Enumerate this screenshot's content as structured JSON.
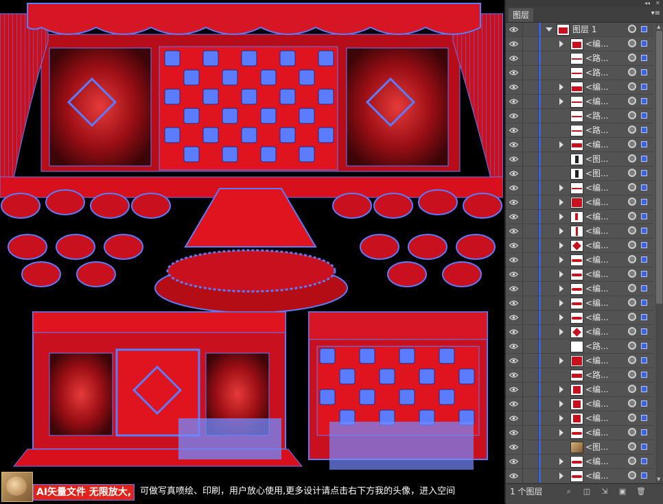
{
  "canvas": {
    "footer_highlight": "AI矢量文件 无限放大,",
    "footer_text": "可做写真喷绘、印刷，用户放心使用,更多设计请点击右下方我的头像，进入空间"
  },
  "panel": {
    "tab_label": "图层",
    "menu_icon": "panel-menu-icon",
    "layer_count": "1 个图层",
    "parent_layer": {
      "name": "图层 1",
      "expanded": true
    },
    "layers": [
      {
        "name": "<编...",
        "expand": true,
        "thumb": "stage-top"
      },
      {
        "name": "<路...",
        "expand": false,
        "thumb": "line"
      },
      {
        "name": "<路...",
        "expand": false,
        "thumb": "line"
      },
      {
        "name": "<编...",
        "expand": true,
        "thumb": "tables"
      },
      {
        "name": "<编...",
        "expand": true,
        "thumb": "line"
      },
      {
        "name": "<路...",
        "expand": false,
        "thumb": "line"
      },
      {
        "name": "<路...",
        "expand": false,
        "thumb": "line"
      },
      {
        "name": "<编...",
        "expand": true,
        "thumb": "bar"
      },
      {
        "name": "<图...",
        "expand": false,
        "thumb": "figure"
      },
      {
        "name": "<图...",
        "expand": false,
        "thumb": "figure"
      },
      {
        "name": "<编...",
        "expand": true,
        "thumb": "line"
      },
      {
        "name": "<编...",
        "expand": true,
        "thumb": "curtain"
      },
      {
        "name": "<编...",
        "expand": true,
        "thumb": "drop"
      },
      {
        "name": "<编...",
        "expand": true,
        "thumb": "post"
      },
      {
        "name": "<编...",
        "expand": true,
        "thumb": "diamond"
      },
      {
        "name": "<编...",
        "expand": true,
        "thumb": "swag"
      },
      {
        "name": "<编...",
        "expand": true,
        "thumb": "swag"
      },
      {
        "name": "<编...",
        "expand": true,
        "thumb": "swag"
      },
      {
        "name": "<编...",
        "expand": true,
        "thumb": "swag"
      },
      {
        "name": "<编...",
        "expand": true,
        "thumb": "swag"
      },
      {
        "name": "<编...",
        "expand": true,
        "thumb": "diamond"
      },
      {
        "name": "<路...",
        "expand": false,
        "thumb": "blank"
      },
      {
        "name": "<编...",
        "expand": true,
        "thumb": "curtain"
      },
      {
        "name": "<路...",
        "expand": false,
        "thumb": "bar"
      },
      {
        "name": "<编...",
        "expand": true,
        "thumb": "square"
      },
      {
        "name": "<编...",
        "expand": true,
        "thumb": "square"
      },
      {
        "name": "<编...",
        "expand": true,
        "thumb": "square"
      },
      {
        "name": "<编...",
        "expand": true,
        "thumb": "swag"
      },
      {
        "name": "<图...",
        "expand": false,
        "thumb": "photo"
      },
      {
        "name": "<编...",
        "expand": true,
        "thumb": "swag"
      },
      {
        "name": "<编...",
        "expand": true,
        "thumb": "swag"
      }
    ]
  },
  "colors": {
    "stage_red": "#d8101e",
    "selection_blue": "#5b7cff",
    "panel_bg": "#535353",
    "layer_color": "#3c63e0"
  }
}
